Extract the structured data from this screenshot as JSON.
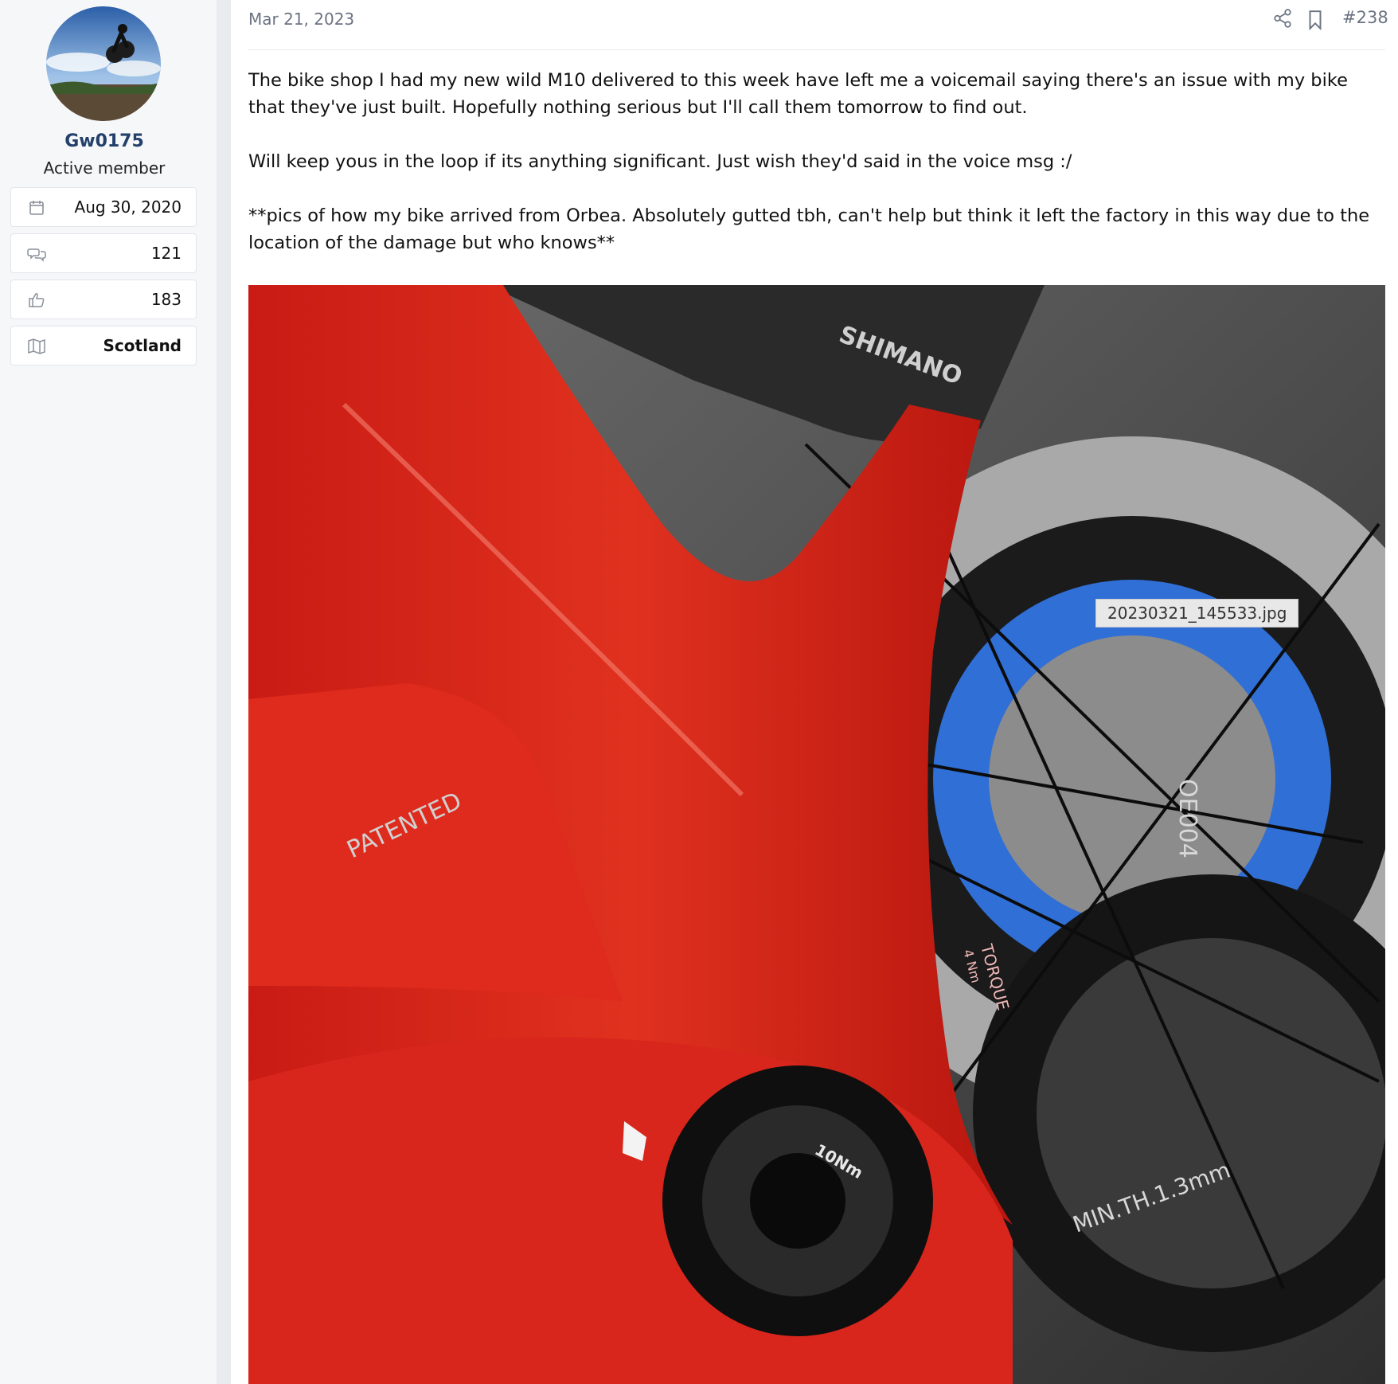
{
  "user": {
    "name": "Gw0175",
    "title": "Active member",
    "stats": {
      "joined": "Aug 30, 2020",
      "messages": "121",
      "reactions": "183",
      "location": "Scotland"
    }
  },
  "post": {
    "date": "Mar 21, 2023",
    "number": "#238",
    "paragraphs": [
      "The bike shop I had my new wild M10 delivered to this week have left me a voicemail saying there's an issue with my bike that they've just built. Hopefully nothing serious but I'll call them tomorrow to find out.",
      "Will keep yous in the loop if its anything significant. Just wish they'd said in the voice msg :/",
      "**pics of how my bike arrived from Orbea. Absolutely gutted tbh, can't help but think it left the factory in this way due to the location of the damage but who knows**"
    ],
    "attachment": {
      "filename": "20230321_145533.jpg",
      "photo_text": {
        "brand": "SHIMANO",
        "patented": "PATENTED",
        "code": "OE004",
        "torque": "TORQUE",
        "torque_value": "4 Nm",
        "bb_torque": "10Nm",
        "min_thickness": "MIN.TH.1.3mm"
      }
    }
  },
  "icons": {
    "joined": "calendar-icon",
    "messages": "chat-bubbles-icon",
    "reactions": "thumbs-up-icon",
    "location": "map-icon",
    "share": "share-icon",
    "bookmark": "bookmark-icon"
  },
  "colors": {
    "username": "#23406b",
    "frame_red": "#d8261c",
    "meta_grey": "#6b7382"
  }
}
